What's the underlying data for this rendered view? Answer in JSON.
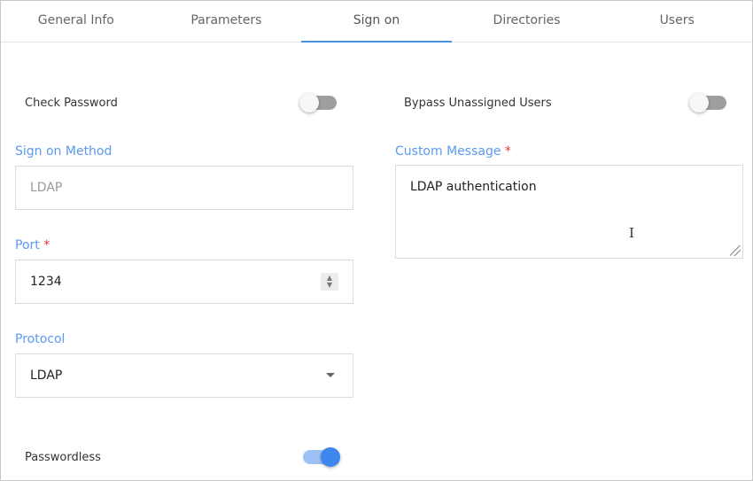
{
  "tabs": [
    {
      "label": "General Info",
      "active": false
    },
    {
      "label": "Parameters",
      "active": false
    },
    {
      "label": "Sign on",
      "active": true
    },
    {
      "label": "Directories",
      "active": false
    },
    {
      "label": "Users",
      "active": false
    }
  ],
  "toggles": {
    "check_password": {
      "label": "Check Password",
      "on": false
    },
    "bypass_unassigned": {
      "label": "Bypass Unassigned Users",
      "on": false
    },
    "passwordless": {
      "label": "Passwordless",
      "on": true
    }
  },
  "fields": {
    "sign_on_method": {
      "label": "Sign on Method",
      "value": "LDAP"
    },
    "port": {
      "label": "Port",
      "required_mark": "*",
      "value": "1234"
    },
    "protocol": {
      "label": "Protocol",
      "value": "LDAP"
    },
    "custom_message": {
      "label": "Custom Message",
      "required_mark": "*",
      "value": "LDAP authentication"
    }
  },
  "colors": {
    "accent": "#4a90e2",
    "label": "#5b9af0",
    "required": "#e53935"
  }
}
